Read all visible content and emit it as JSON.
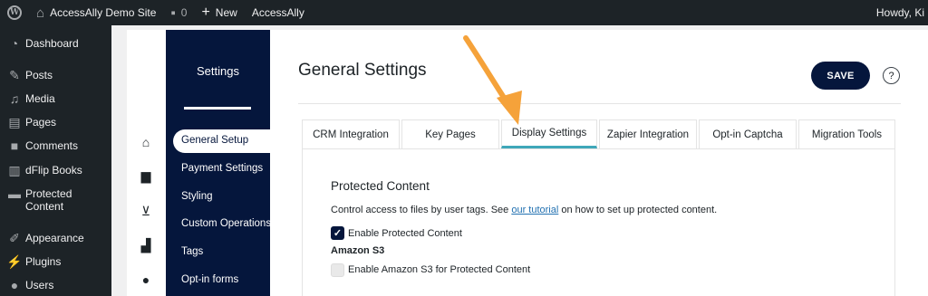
{
  "adminbar": {
    "site_name": "AccessAlly Demo Site",
    "comments_count": "0",
    "new_label": "New",
    "plugin_label": "AccessAlly",
    "howdy": "Howdy, Ki"
  },
  "menu": {
    "items": [
      {
        "label": "Dashboard",
        "icon": "gauge-icon"
      },
      {
        "label": "Posts",
        "icon": "pin-icon"
      },
      {
        "label": "Media",
        "icon": "media-icon"
      },
      {
        "label": "Pages",
        "icon": "pages-icon"
      },
      {
        "label": "Comments",
        "icon": "comment-icon"
      },
      {
        "label": "dFlip Books",
        "icon": "book-icon"
      },
      {
        "label": "Protected Content",
        "icon": "folder-icon"
      },
      {
        "label": "Appearance",
        "icon": "brush-icon"
      },
      {
        "label": "Plugins",
        "icon": "plug-icon"
      },
      {
        "label": "Users",
        "icon": "user-icon"
      }
    ]
  },
  "plugin_icons": [
    "home-icon",
    "store-icon",
    "cart-icon",
    "chart-icon",
    "person-icon"
  ],
  "settings_nav": {
    "title": "Settings",
    "items": [
      "General Setup",
      "Payment Settings",
      "Styling",
      "Custom Operations",
      "Tags",
      "Opt-in forms"
    ],
    "active_index": 0
  },
  "page": {
    "title": "General Settings",
    "save_label": "SAVE",
    "help_label": "?"
  },
  "tabs": {
    "items": [
      "CRM Integration",
      "Key Pages",
      "Display Settings",
      "Zapier Integration",
      "Opt-in Captcha",
      "Migration Tools"
    ],
    "active_index": 2
  },
  "panel": {
    "section_title": "Protected Content",
    "desc_before": "Control access to files by user tags. See ",
    "desc_link": "our tutorial",
    "desc_after": " on how to set up protected content.",
    "enable_protected_label": "Enable Protected Content",
    "enable_protected_checked": true,
    "s3_title": "Amazon S3",
    "enable_s3_label": "Enable Amazon S3 for Protected Content",
    "enable_s3_checked": false
  },
  "colors": {
    "navy": "#05163c",
    "admin_dark": "#1d2327",
    "tab_accent": "#3fa7b9",
    "arrow": "#f5a23a",
    "link": "#2271b1"
  }
}
